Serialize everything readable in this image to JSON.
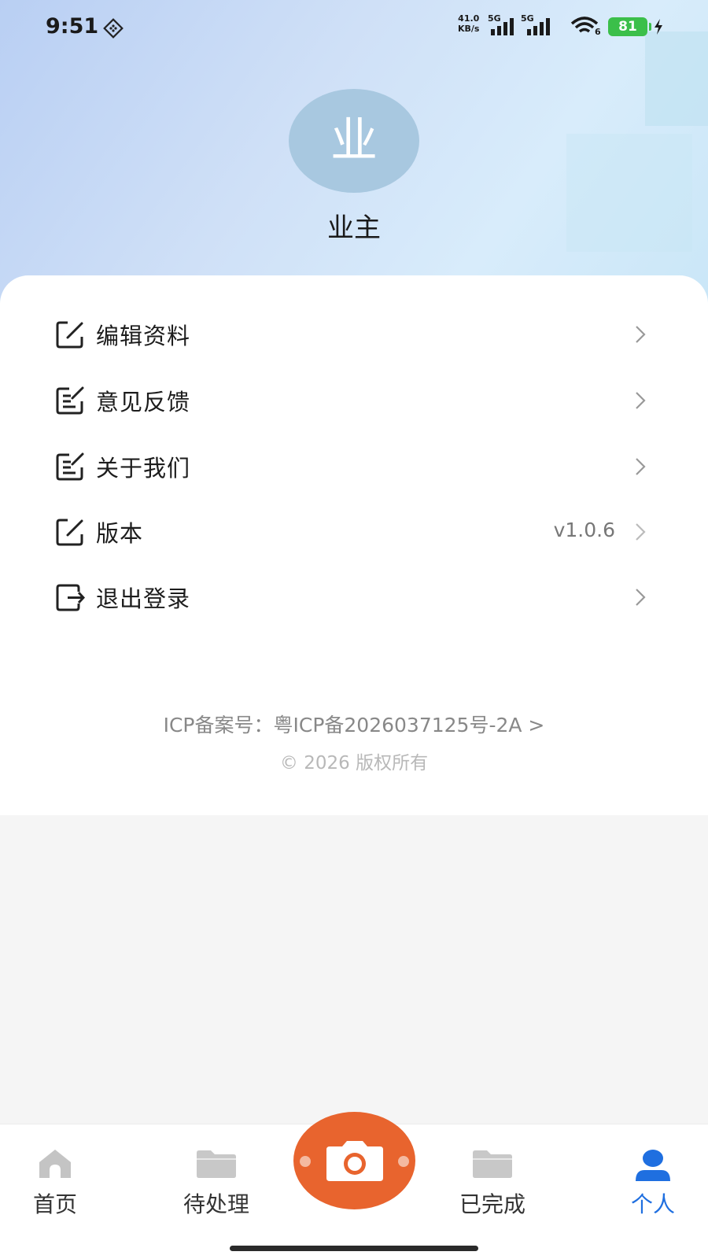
{
  "status_bar": {
    "time": "9:51",
    "net_speed_value": "41.0",
    "net_speed_unit": "KB/s",
    "signal1_label": "5G",
    "signal2_label": "5G",
    "wifi_badge": "6",
    "battery": "81"
  },
  "profile": {
    "avatar_text": "业",
    "name": "业主"
  },
  "menu": {
    "items": [
      {
        "label": "编辑资料",
        "value": "",
        "icon": "edit-icon"
      },
      {
        "label": "意见反馈",
        "value": "",
        "icon": "note-edit-icon"
      },
      {
        "label": "关于我们",
        "value": "",
        "icon": "note-edit-icon"
      },
      {
        "label": "版本",
        "value": "v1.0.6",
        "icon": "edit-icon"
      },
      {
        "label": "退出登录",
        "value": "",
        "icon": "logout-icon"
      }
    ]
  },
  "footer": {
    "icp": "ICP备案号：粤ICP备2026037125号-2A >",
    "copyright": "© 2026 版权所有"
  },
  "tabbar": {
    "tabs": [
      {
        "label": "首页",
        "icon": "home-icon",
        "active": false
      },
      {
        "label": "待处理",
        "icon": "folder-icon",
        "active": false
      },
      {
        "label": "已完成",
        "icon": "folder-icon",
        "active": false
      },
      {
        "label": "个人",
        "icon": "user-icon",
        "active": true
      }
    ],
    "center_button_icon": "camera-icon"
  },
  "colors": {
    "accent": "#e8642e",
    "active_tab": "#1f6fe0",
    "battery": "#3bbf4a"
  }
}
